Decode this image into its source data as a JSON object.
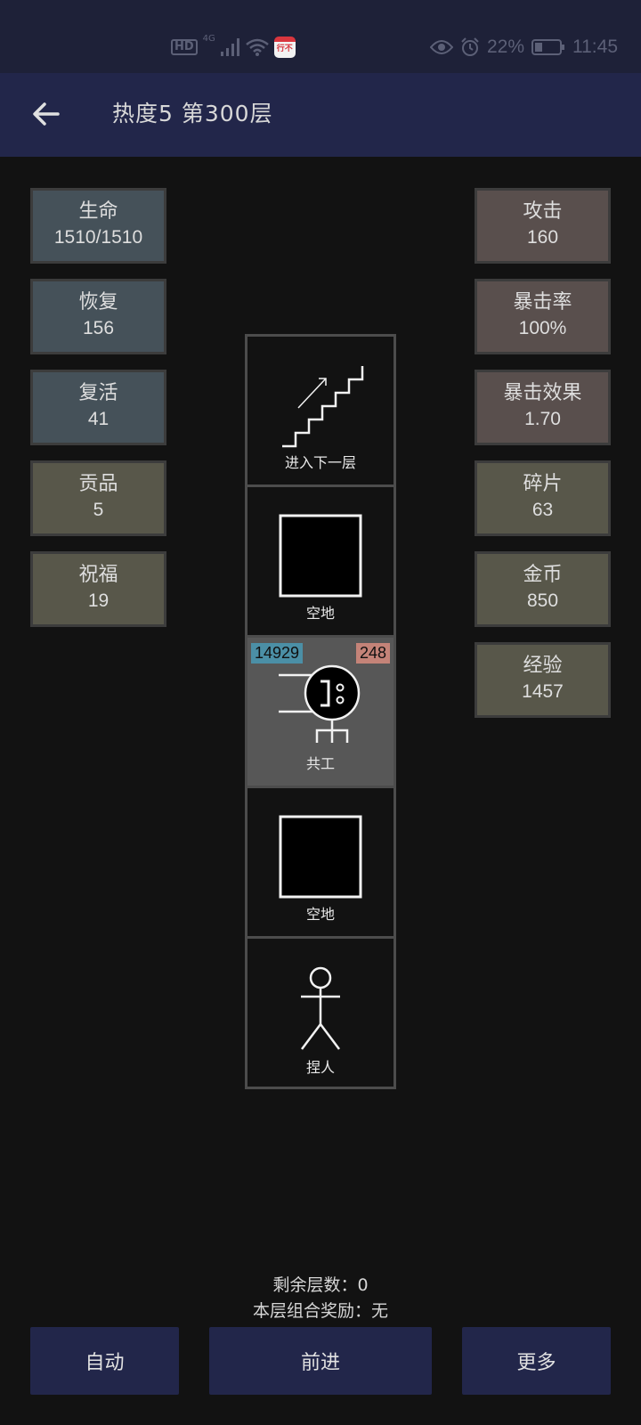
{
  "status_bar": {
    "hd": "HD",
    "network": "4G",
    "app_icon_text": "行不",
    "battery": "22%",
    "time": "11:45"
  },
  "header": {
    "title": "热度5 第300层"
  },
  "left_stats": [
    {
      "label": "生命",
      "value": "1510/1510",
      "color": "#455159"
    },
    {
      "label": "恢复",
      "value": "156",
      "color": "#455159"
    },
    {
      "label": "复活",
      "value": "41",
      "color": "#455159"
    },
    {
      "label": "贡品",
      "value": "5",
      "color": "#58574a"
    },
    {
      "label": "祝福",
      "value": "19",
      "color": "#58574a"
    }
  ],
  "right_stats": [
    {
      "label": "攻击",
      "value": "160",
      "color": "#594f4d"
    },
    {
      "label": "暴击率",
      "value": "100%",
      "color": "#594f4d"
    },
    {
      "label": "暴击效果",
      "value": "1.70",
      "color": "#594f4d"
    },
    {
      "label": "碎片",
      "value": "63",
      "color": "#58574a"
    },
    {
      "label": "金币",
      "value": "850",
      "color": "#58574a"
    },
    {
      "label": "经验",
      "value": "1457",
      "color": "#58574a"
    }
  ],
  "floor_cells": [
    {
      "label": "进入下一层",
      "icon": "stairs-up-icon"
    },
    {
      "label": "空地",
      "icon": "empty-square-icon"
    },
    {
      "label": "共工",
      "icon": "gonggong-monster-icon",
      "hp": "14929",
      "atk": "248"
    },
    {
      "label": "空地",
      "icon": "empty-square-icon"
    },
    {
      "label": "捏人",
      "icon": "stick-figure-icon"
    }
  ],
  "info": {
    "remaining_floors": "剩余层数：0",
    "combo_reward": "本层组合奖励：无"
  },
  "buttons": {
    "auto": "自动",
    "forward": "前进",
    "more": "更多"
  }
}
